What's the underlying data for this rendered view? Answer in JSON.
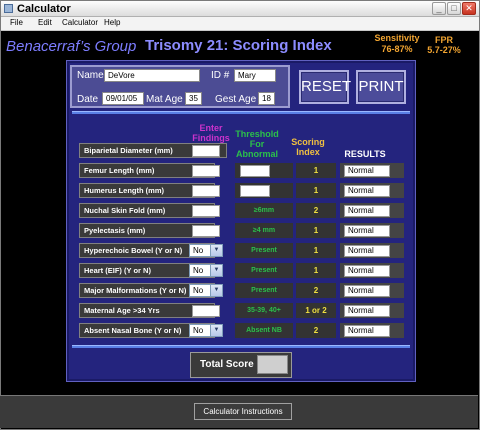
{
  "window": {
    "title": "Calculator"
  },
  "menu": [
    "File",
    "Edit",
    "Calculator",
    "Help"
  ],
  "header": {
    "group": "Benacerraf’s Group",
    "title": "Trisomy 21: Scoring Index",
    "sensitivity_label": "Sensitivity",
    "sensitivity_value": "76-87%",
    "fpr_label": "FPR",
    "fpr_value": "5.7-27%"
  },
  "patient": {
    "name_label": "Name",
    "name_value": "DeVore",
    "id_label": "ID #",
    "id_value": "Mary",
    "date_label": "Date",
    "date_value": "09/01/05",
    "mat_age_label": "Mat Age",
    "mat_age_value": "35",
    "gest_age_label": "Gest Age",
    "gest_age_value": "18"
  },
  "buttons": {
    "reset": "RESET",
    "print": "PRINT",
    "instructions": "Calculator Instructions"
  },
  "columns": {
    "findings": "Enter Findings",
    "threshold": "Threshold For Abnormal",
    "score": "Scoring Index",
    "results": "RESULTS"
  },
  "rows": [
    {
      "label": "Biparietal Diameter (mm)",
      "threshold": "",
      "score": "",
      "result": ""
    },
    {
      "label": "Femur Length (mm)",
      "threshold": "",
      "score": "1",
      "result": "Normal"
    },
    {
      "label": "Humerus Length (mm)",
      "threshold": "",
      "score": "1",
      "result": "Normal"
    },
    {
      "label": "Nuchal Skin Fold (mm)",
      "threshold": "≥6mm",
      "score": "2",
      "result": "Normal"
    },
    {
      "label": "Pyelectasis (mm)",
      "threshold": "≥4 mm",
      "score": "1",
      "result": "Normal"
    },
    {
      "label": "Hyperechoic Bowel (Y or N)",
      "select": "No",
      "threshold": "Present",
      "score": "1",
      "result": "Normal"
    },
    {
      "label": "Heart  (EIF) (Y or N)",
      "select": "No",
      "threshold": "Present",
      "score": "1",
      "result": "Normal"
    },
    {
      "label": "Major  Malformations (Y or N)",
      "select": "No",
      "threshold": "Present",
      "score": "2",
      "result": "Normal"
    },
    {
      "label": "Maternal Age >34 Yrs",
      "threshold": "35-39, 40+",
      "score": "1 or 2",
      "result": "Normal"
    },
    {
      "label": "Absent Nasal Bone (Y or N)",
      "select": "No",
      "threshold": "Absent NB",
      "score": "2",
      "result": "Normal"
    }
  ],
  "total": {
    "label": "Total Score",
    "value": ""
  },
  "colors": {
    "accent": "#8c8cff",
    "panel": "#24247e",
    "threshold_text": "#2bc04a",
    "score_text": "#f0e040",
    "findings_header": "#cc33cc"
  }
}
